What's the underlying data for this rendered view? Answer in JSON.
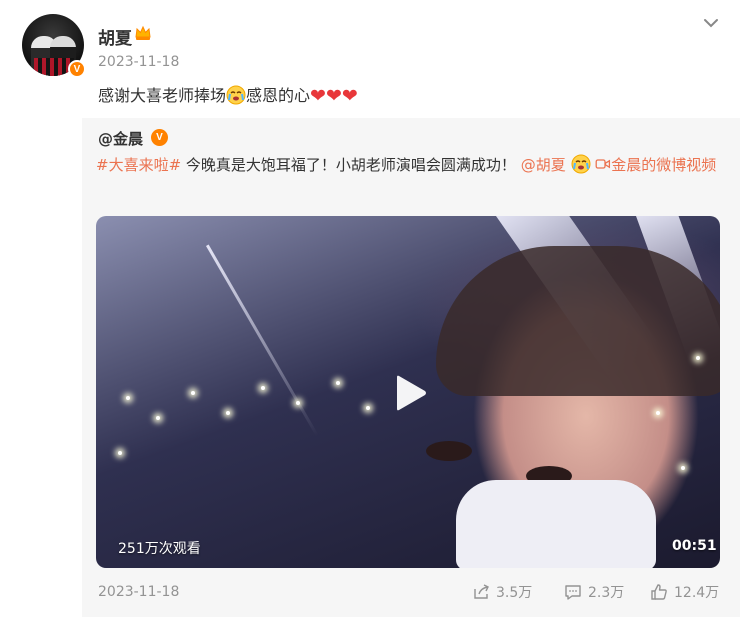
{
  "post": {
    "author": "胡夏",
    "time": "2023-11-18",
    "content_text": "感谢大喜老师捧场",
    "content_text_2": "感恩的心",
    "hearts": "❤❤❤"
  },
  "repost": {
    "author": "@金晨",
    "hashtag": "#大喜来啦#",
    "body": " 今晚真是大饱耳福了！小胡老师演唱会圆满成功！",
    "mention": "@胡夏",
    "video_link": "金晨的微博视频",
    "video": {
      "views": "251万次观看",
      "duration": "00:51"
    },
    "time": "2023-11-18",
    "actions": {
      "repost_count": "3.5万",
      "comment_count": "2.3万",
      "like_count": "12.4万"
    }
  },
  "colors": {
    "link": "#eb7350",
    "verified_badge": "#ff8200",
    "heart": "#e8373a",
    "muted": "#939393"
  }
}
